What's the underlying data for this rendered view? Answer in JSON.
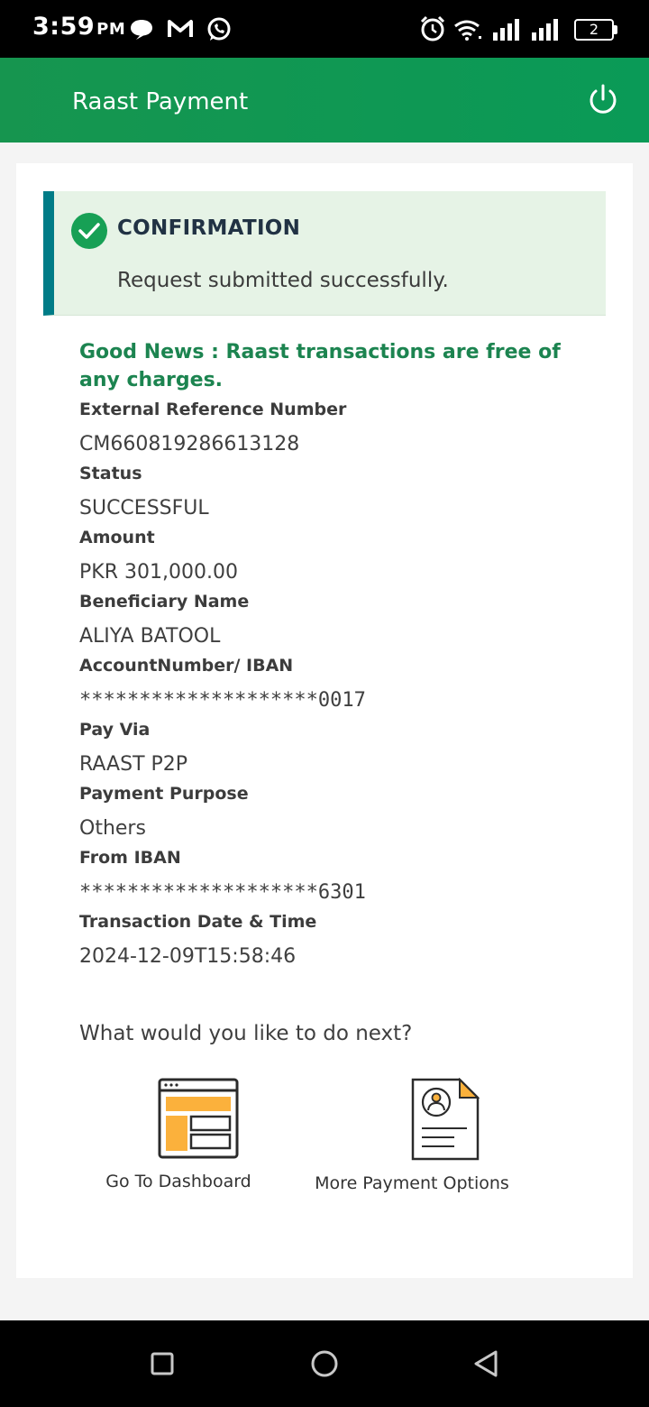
{
  "status_bar": {
    "time": "3:59",
    "ampm": "PM",
    "battery": "2"
  },
  "header": {
    "title": "Raast Payment",
    "accent": "#0f9a55"
  },
  "confirmation": {
    "title": "CONFIRMATION",
    "message": "Request submitted successfully."
  },
  "notice": "Good News : Raast transactions are free of any charges.",
  "details": [
    {
      "label": "External Reference Number",
      "value": "CM660819286613128"
    },
    {
      "label": "Status",
      "value": "SUCCESSFUL"
    },
    {
      "label": "Amount",
      "value": "PKR 301,000.00"
    },
    {
      "label": "Beneficiary Name",
      "value": "ALIYA BATOOL"
    },
    {
      "label": "AccountNumber/ IBAN",
      "value": "********************0017"
    },
    {
      "label": "Pay Via",
      "value": "RAAST P2P"
    },
    {
      "label": "Payment Purpose",
      "value": "Others"
    },
    {
      "label": "From IBAN",
      "value": "********************6301"
    },
    {
      "label": "Transaction Date & Time",
      "value": "2024-12-09T15:58:46"
    }
  ],
  "next": {
    "title": "What would you like to do next?",
    "actions": [
      {
        "label": "Go To Dashboard",
        "icon": "dashboard-icon"
      },
      {
        "label": "More Payment Options",
        "icon": "payment-document-icon"
      }
    ]
  },
  "nav": {
    "icons": [
      "recents-square-icon",
      "home-circle-icon",
      "back-triangle-icon"
    ]
  }
}
